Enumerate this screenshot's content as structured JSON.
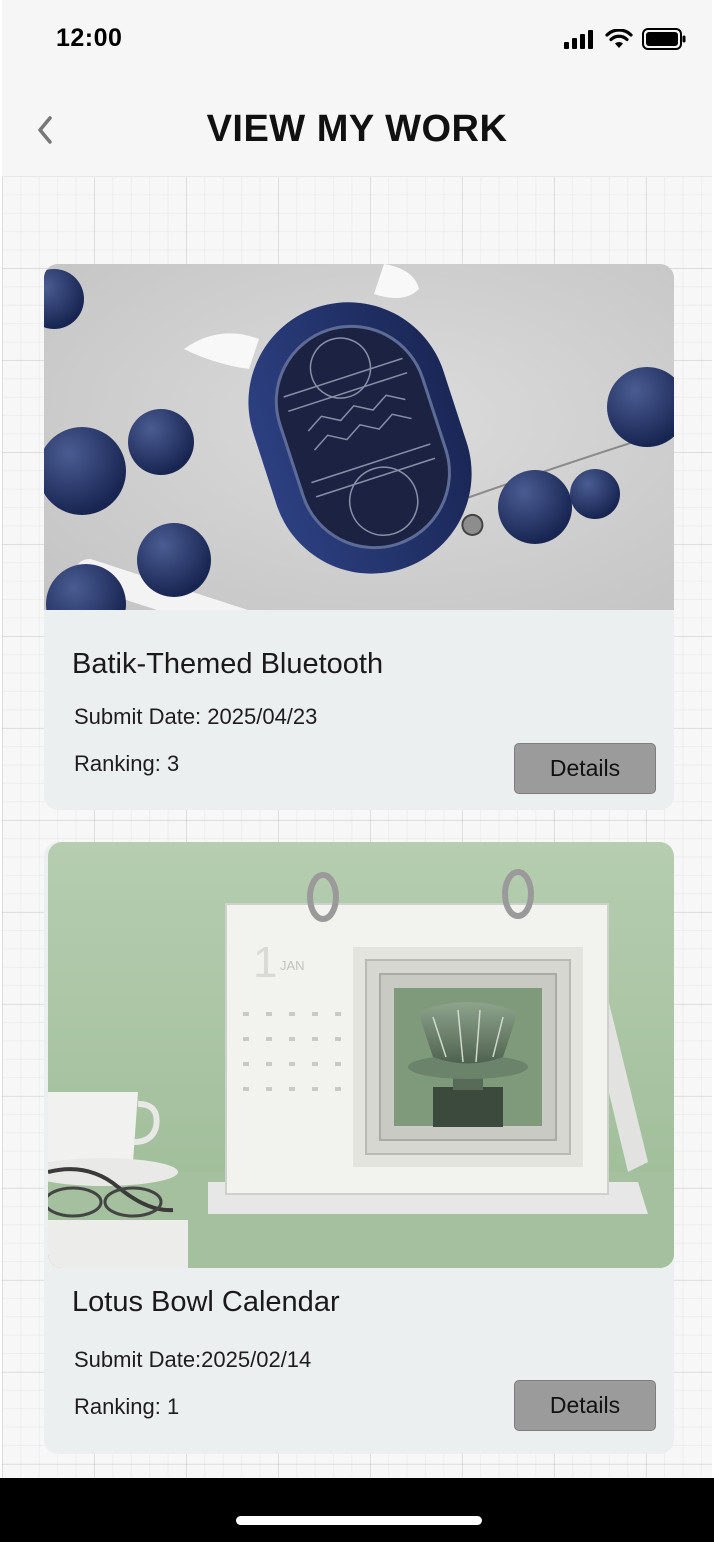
{
  "status_bar": {
    "time": "12:00"
  },
  "header": {
    "title": "VIEW MY WORK"
  },
  "works": [
    {
      "title": "Batik-Themed Bluetooth",
      "submit_date": "Submit Date: 2025/04/23",
      "ranking": "Ranking: 3",
      "details_label": "Details",
      "image": "bluetooth-speaker-photo"
    },
    {
      "title": "Lotus Bowl Calendar",
      "submit_date": "Submit Date:2025/02/14",
      "ranking": "Ranking: 1",
      "details_label": "Details",
      "image": "lotus-bowl-calendar-photo"
    }
  ],
  "colors": {
    "card_bg": "#eceff0",
    "button_bg": "#9b9b9b",
    "speaker_blue": "#24346b",
    "calendar_green": "#a8c4a2"
  }
}
